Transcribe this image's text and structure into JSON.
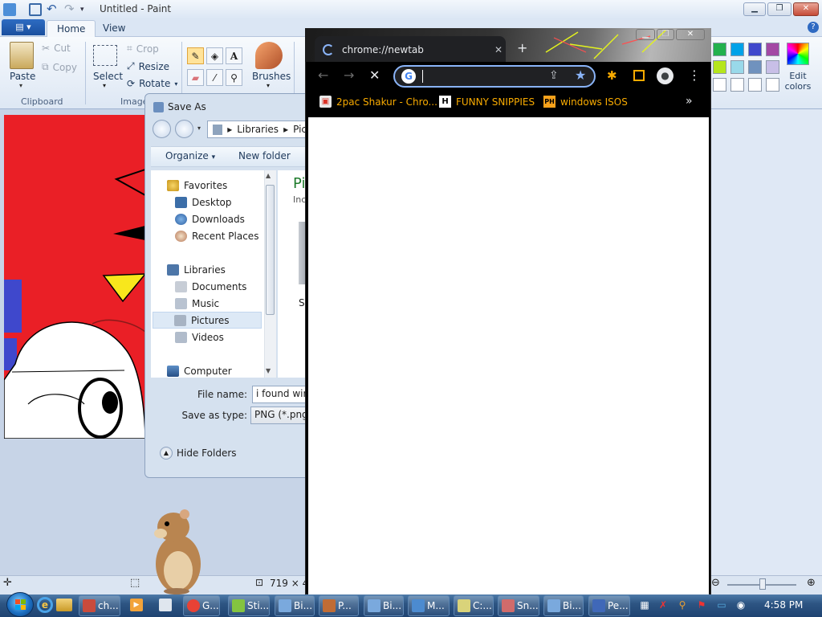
{
  "paint": {
    "title": "Untitled - Paint",
    "tabs": [
      "Home",
      "View"
    ],
    "clipboard": {
      "paste": "Paste",
      "cut": "Cut",
      "copy": "Copy",
      "label": "Clipboard"
    },
    "image": {
      "select": "Select",
      "crop": "Crop",
      "resize": "Resize",
      "rotate": "Rotate",
      "label": "Image"
    },
    "brushes": "Brushes",
    "edit_colors": "Edit colors",
    "status_size": "719 × 40",
    "palette_colors": [
      "#23b14d",
      "#00a2e8",
      "#3f48cc",
      "#a349a4",
      "#b5e61d",
      "#99d9ea",
      "#7092be",
      "#c8bfe7"
    ]
  },
  "save_as": {
    "title": "Save As",
    "breadcrumb": [
      "Libraries",
      "Pic"
    ],
    "organize": "Organize",
    "new_folder": "New folder",
    "nav": {
      "favorites": "Favorites",
      "desktop": "Desktop",
      "downloads": "Downloads",
      "recent": "Recent Places",
      "libraries": "Libraries",
      "documents": "Documents",
      "music": "Music",
      "pictures": "Pictures",
      "videos": "Videos",
      "computer": "Computer"
    },
    "content_title": "Pi",
    "content_sub": "Inc",
    "content_item": "S",
    "file_name_label": "File name:",
    "file_name_value": "i found win",
    "save_type_label": "Save as type:",
    "save_type_value": "PNG (*.png)",
    "hide_folders": "Hide Folders"
  },
  "chrome": {
    "tab_title": "chrome://newtab",
    "bookmarks": [
      {
        "label": "2pac Shakur - Chro...",
        "icon": "chrome-store-icon"
      },
      {
        "label": "FUNNY SNIPPIES",
        "icon": "h-letter-icon",
        "glyph": "H"
      },
      {
        "label": "windows ISOS",
        "icon": "ph-icon",
        "glyph": "PH"
      }
    ],
    "more_bookmarks": "»",
    "accent": "#8ab4f8",
    "bookmark_color": "#f9ab00"
  },
  "taskbar": {
    "clock": "4:58 PM",
    "items": [
      {
        "label": "ch...",
        "icon": "paint-icon",
        "color": "#c94b3c"
      },
      {
        "label": "G...",
        "icon": "chrome-icon",
        "color": "#e94235"
      },
      {
        "label": "Sti...",
        "icon": "sticky-icon",
        "color": "#84c440"
      },
      {
        "label": "Bi...",
        "icon": "window-icon",
        "color": "#7aa9dd"
      },
      {
        "label": "P...",
        "icon": "paint-icon",
        "color": "#c06c35"
      },
      {
        "label": "Bi...",
        "icon": "window-icon",
        "color": "#7aa9dd"
      },
      {
        "label": "M...",
        "icon": "monitor-icon",
        "color": "#4c8bd0"
      },
      {
        "label": "C:...",
        "icon": "notepad-icon",
        "color": "#d9d37a"
      },
      {
        "label": "Sn...",
        "icon": "snipping-icon",
        "color": "#d06b6b"
      },
      {
        "label": "Bi...",
        "icon": "window-icon",
        "color": "#7aa9dd"
      },
      {
        "label": "Pe...",
        "icon": "paint-icon",
        "color": "#4068b8"
      }
    ]
  }
}
